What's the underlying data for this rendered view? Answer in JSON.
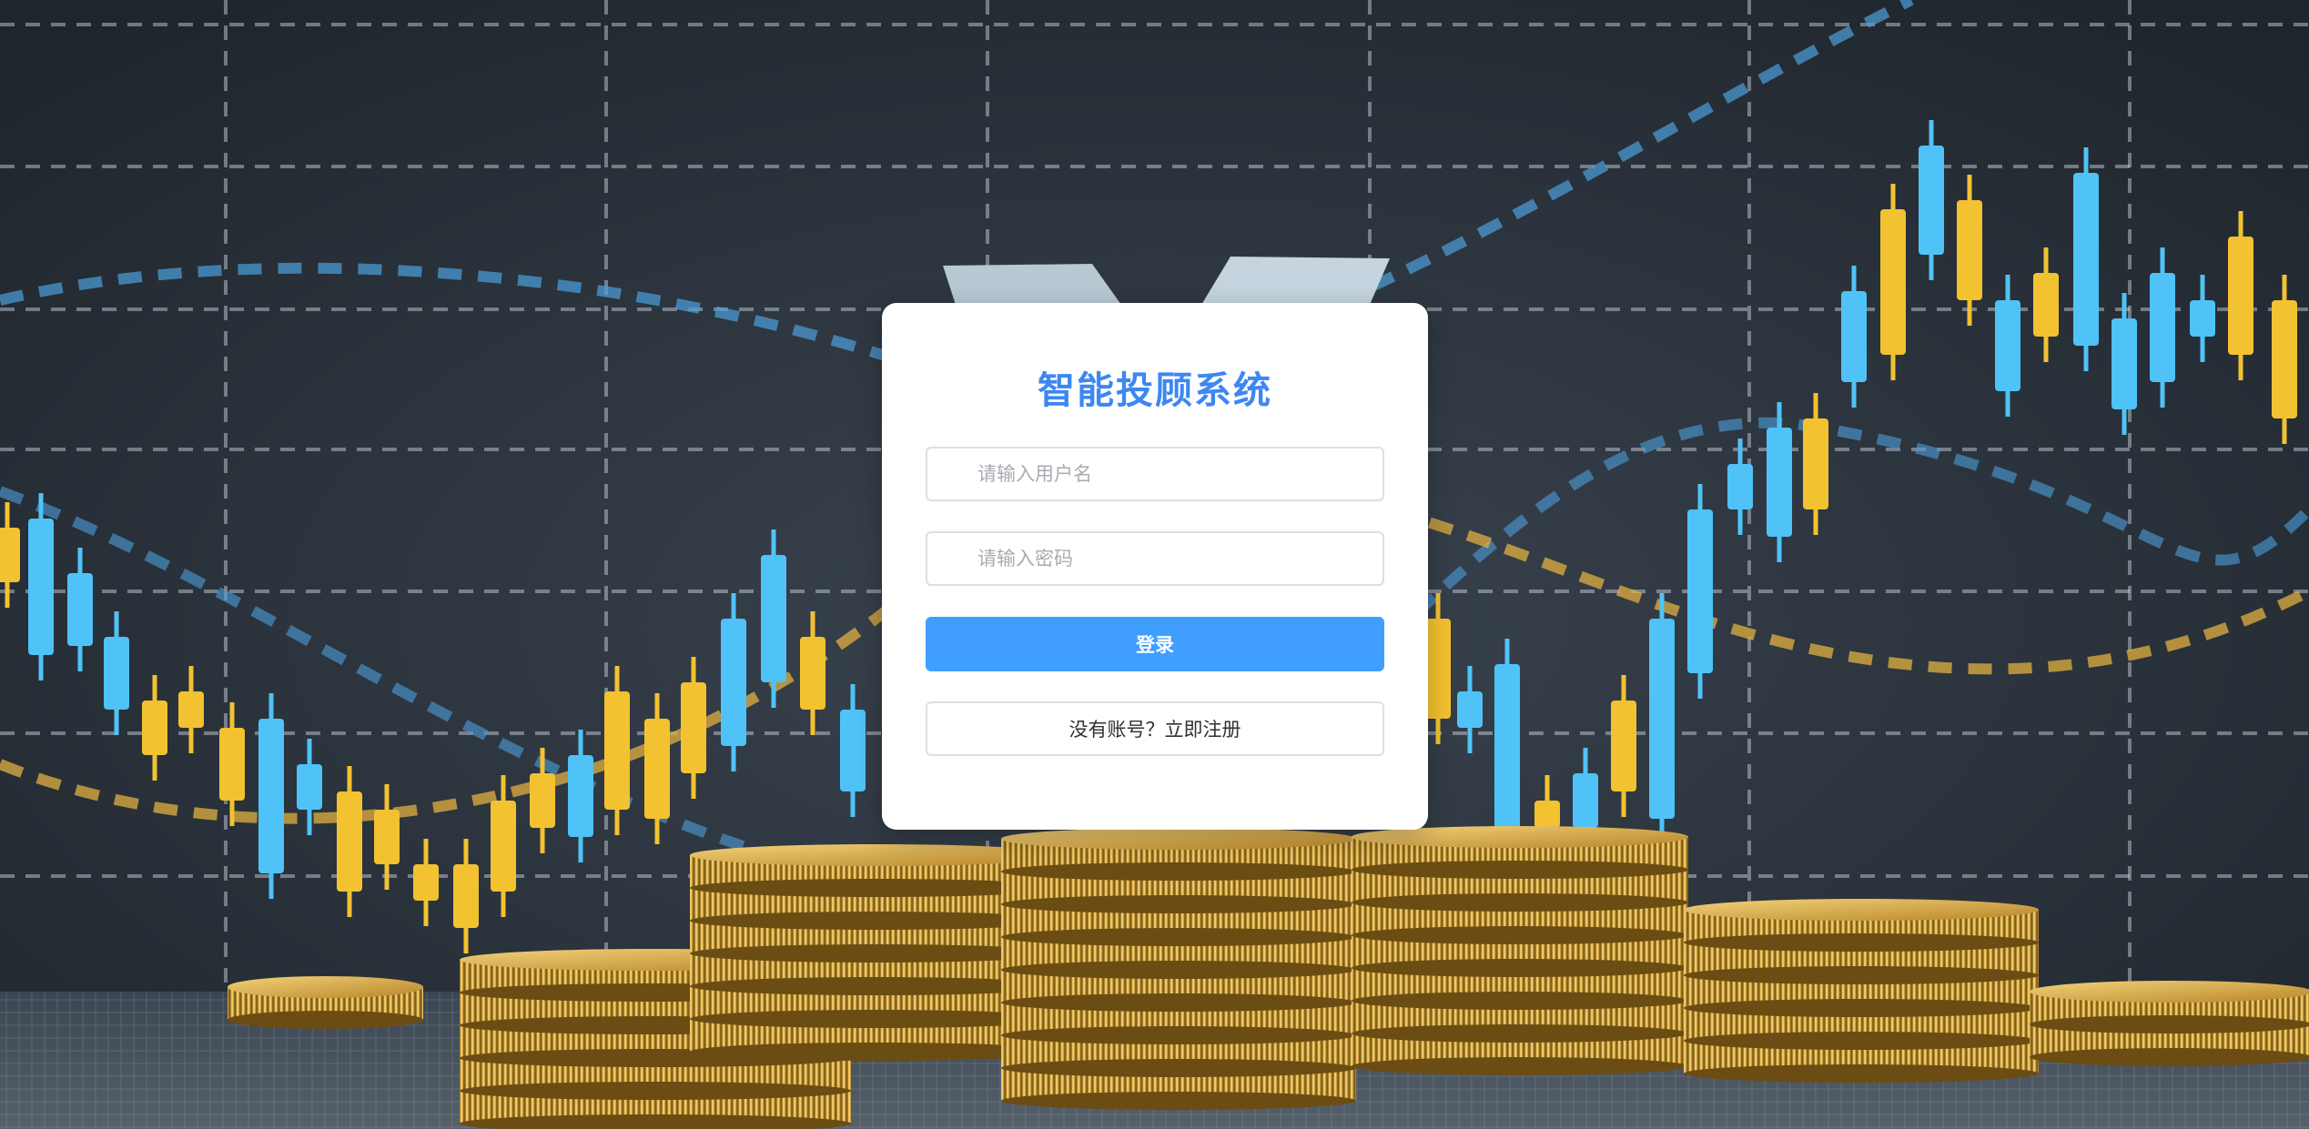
{
  "app": {
    "title": "智能投顾系统"
  },
  "login_form": {
    "username_placeholder": "请输入用户名",
    "password_placeholder": "请输入密码",
    "login_label": "登录",
    "register_label": "没有账号？立即注册"
  },
  "colors": {
    "title": "#3d87f2",
    "primary_button": "#409eff",
    "background": "#2b3138",
    "candle_gold": "#f2c230",
    "candle_blue": "#4fc3f7",
    "coin_gold": "#c9982e"
  }
}
